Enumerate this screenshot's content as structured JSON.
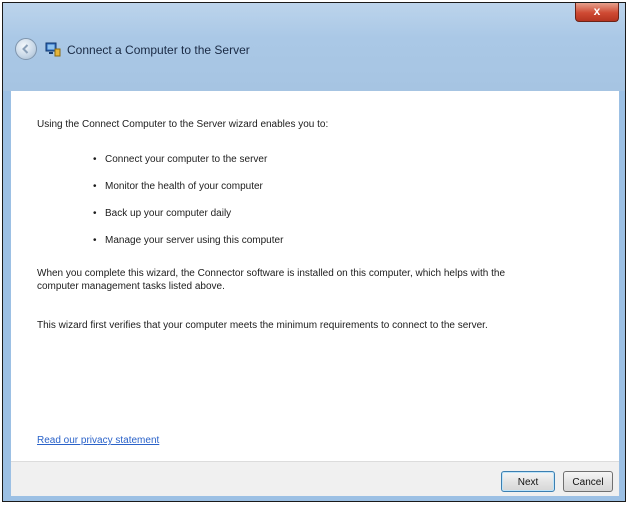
{
  "window": {
    "title": "Connect a Computer to the Server",
    "close_label": "x"
  },
  "content": {
    "intro": "Using the Connect Computer to the Server wizard enables you to:",
    "bullets": [
      "Connect your computer to the server",
      "Monitor the health of your computer",
      "Back up your computer daily",
      "Manage your server using this computer"
    ],
    "paragraph1": "When you complete this wizard, the Connector software is installed on this computer, which helps with the computer management tasks listed above.",
    "paragraph2": "This wizard first verifies that your computer meets the minimum requirements to connect to the server.",
    "privacy_link": "Read our privacy statement"
  },
  "footer": {
    "next_label": "Next",
    "cancel_label": "Cancel"
  },
  "colors": {
    "titlebar": "#a6c4e2",
    "link": "#2a62c9",
    "close": "#cf4a33"
  },
  "icons": [
    "back-arrow-icon",
    "connector-app-icon",
    "close-icon"
  ]
}
